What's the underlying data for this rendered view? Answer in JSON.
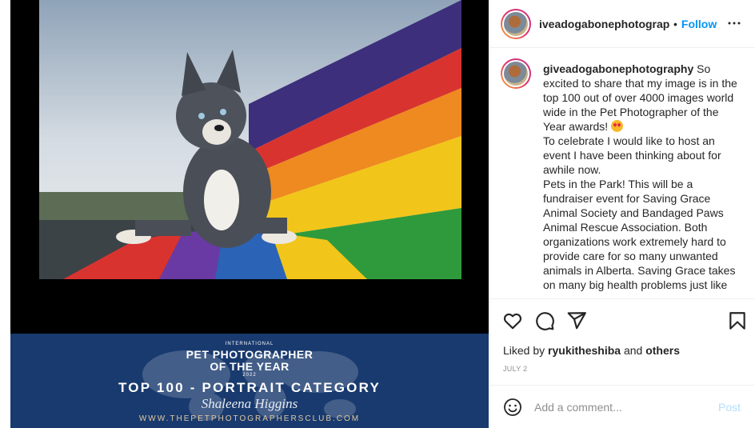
{
  "post": {
    "username": "iveadogabonephotography",
    "follow_label": "Follow",
    "separator": "•"
  },
  "caption": {
    "username": "giveadogabonephotography",
    "paragraphs": [
      "So excited to share that my image is in the top 100 out of over 4000 images world wide in the Pet Photographer of the Year awards!",
      "To celebrate I would like to host an event I have been thinking about for awhile now.",
      "Pets in the Park! This will be a fundraiser event for Saving Grace Animal Society and Bandaged Paws Animal Rescue Association. Both organizations work extremely hard to provide care for so many unwanted animals in Alberta. Saving Grace takes on many big health problems just like"
    ],
    "emoji": "heart-eyes-emoji"
  },
  "banner": {
    "intl": "INTERNATIONAL",
    "title_line1": "PET PHOTOGRAPHER",
    "title_line2": "OF THE YEAR",
    "year": "2022",
    "category": "TOP 100 - PORTRAIT CATEGORY",
    "name": "Shaleena Higgins",
    "url": "WWW.THEPETPHOTOGRAPHERSCLUB.COM"
  },
  "engagement": {
    "liked_by_prefix": "Liked by ",
    "liked_by_user": "ryukitheshiba",
    "and": " and ",
    "others": "others",
    "date": "JULY 2"
  },
  "comment": {
    "placeholder": "Add a comment...",
    "post_label": "Post"
  },
  "icons": {
    "more": "more-options-icon",
    "like": "heart-icon",
    "comment": "comment-icon",
    "share": "share-icon",
    "save": "bookmark-icon",
    "emoji": "smiley-icon"
  },
  "colors": {
    "accent": "#0095f6",
    "banner": "#193a6e",
    "post_disabled": "#b2dffc"
  }
}
